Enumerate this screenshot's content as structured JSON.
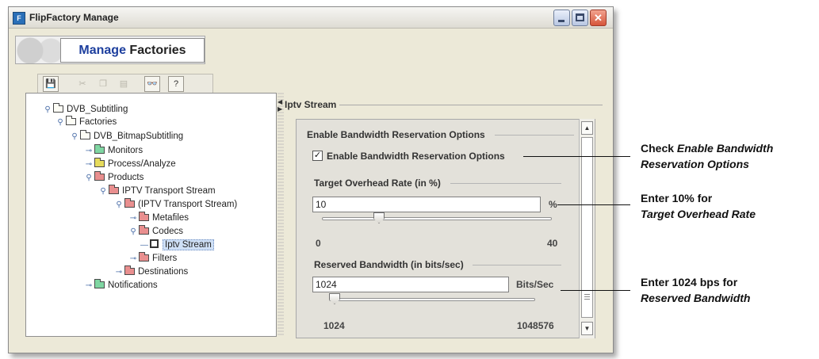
{
  "window": {
    "title": "FlipFactory Manage",
    "icon": "app-icon",
    "controls": [
      "minimize-icon",
      "maximize-icon",
      "close-icon"
    ]
  },
  "header": {
    "title_bold": "Manage",
    "title_rest": " Factories"
  },
  "toolbar": {
    "buttons": [
      {
        "icon": "save-icon",
        "enabled": true
      },
      {
        "icon": "cut-icon",
        "enabled": false
      },
      {
        "icon": "copy-icon",
        "enabled": false
      },
      {
        "icon": "paste-icon",
        "enabled": false
      },
      {
        "icon": "find-icon",
        "enabled": true
      },
      {
        "icon": "help-icon",
        "enabled": true
      }
    ]
  },
  "tree": {
    "nodes": [
      {
        "label": "DVB_Subtitling",
        "folder": "plain",
        "expanded": true
      },
      {
        "label": "Factories",
        "folder": "plain",
        "expanded": true
      },
      {
        "label": "DVB_BitmapSubtitling",
        "folder": "plain",
        "expanded": true
      },
      {
        "label": "Monitors",
        "folder": "green",
        "expanded": false
      },
      {
        "label": "Process/Analyze",
        "folder": "yellow",
        "expanded": false
      },
      {
        "label": "Products",
        "folder": "red",
        "expanded": true
      },
      {
        "label": "IPTV Transport Stream",
        "folder": "red",
        "expanded": true
      },
      {
        "label": "(IPTV Transport Stream)",
        "folder": "red",
        "expanded": true
      },
      {
        "label": "Metafiles",
        "folder": "red",
        "expanded": false
      },
      {
        "label": "Codecs",
        "folder": "red",
        "expanded": true
      },
      {
        "label": "Iptv Stream",
        "folder": "film",
        "selected": true
      },
      {
        "label": "Filters",
        "folder": "red",
        "expanded": false
      },
      {
        "label": "Destinations",
        "folder": "red",
        "expanded": false
      },
      {
        "label": "Notifications",
        "folder": "green",
        "expanded": false
      }
    ]
  },
  "panel": {
    "title": "Iptv Stream",
    "bandwidth_group": "Enable Bandwidth Reservation Options",
    "bandwidth_checkbox": {
      "label": "Enable Bandwidth Reservation Options",
      "checked": true,
      "mark": "✓"
    },
    "overhead": {
      "title": "Target Overhead Rate (in %)",
      "value": "10",
      "unit": "%",
      "min": "0",
      "max": "40",
      "slider_fraction": 0.25
    },
    "reserved": {
      "title": "Reserved Bandwidth (in bits/sec)",
      "value": "1024",
      "unit": "Bits/Sec",
      "min": "1024",
      "max": "1048576",
      "slider_fraction": 0.0
    }
  },
  "callouts": {
    "c1_line1_a": "Check ",
    "c1_line1_b": "Enable Bandwidth",
    "c1_line2": "Reservation Options",
    "c2_line1": "Enter 10% for",
    "c2_line2": "Target Overhead Rate",
    "c3_line1": "Enter 1024 bps for",
    "c3_line2": "Reserved Bandwidth"
  }
}
